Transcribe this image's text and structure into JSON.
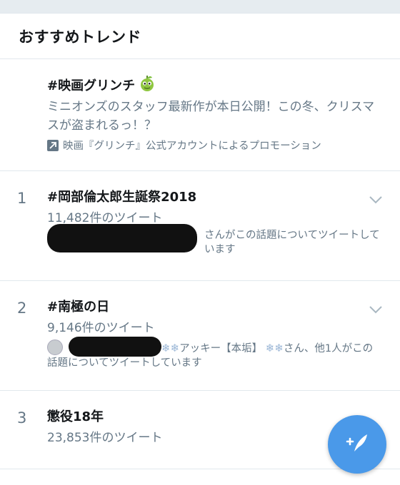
{
  "header": {
    "title": "おすすめトレンド"
  },
  "promoted": {
    "name": "#映画グリンチ",
    "description": "ミニオンズのスタッフ最新作が本日公開！この冬、クリスマスが盗まれるっ！？",
    "promo_text": "映画『グリンチ』公式アカウントによるプロモーション"
  },
  "trends": [
    {
      "rank": "1",
      "name": "#岡部倫太郎生誕祭2018",
      "count": "11,482件のツイート",
      "context": "さんがこの話題についてツイートしています"
    },
    {
      "rank": "2",
      "name": "#南極の日",
      "count": "9,146件のツイート",
      "context_name": "アッキー【本垢】",
      "context": "さん、他1人がこの話題についてツイートしています"
    },
    {
      "rank": "3",
      "name": "懲役18年",
      "count": "23,853件のツイート"
    }
  ],
  "icons": [
    "grinch-emoji-icon",
    "promoted-arrow-icon",
    "chevron-down-icon",
    "snowflake-icon",
    "compose-tweet-icon"
  ],
  "colors": {
    "accent": "#4a99e9",
    "secondary_text": "#657786",
    "divider": "#e1e8ed"
  }
}
